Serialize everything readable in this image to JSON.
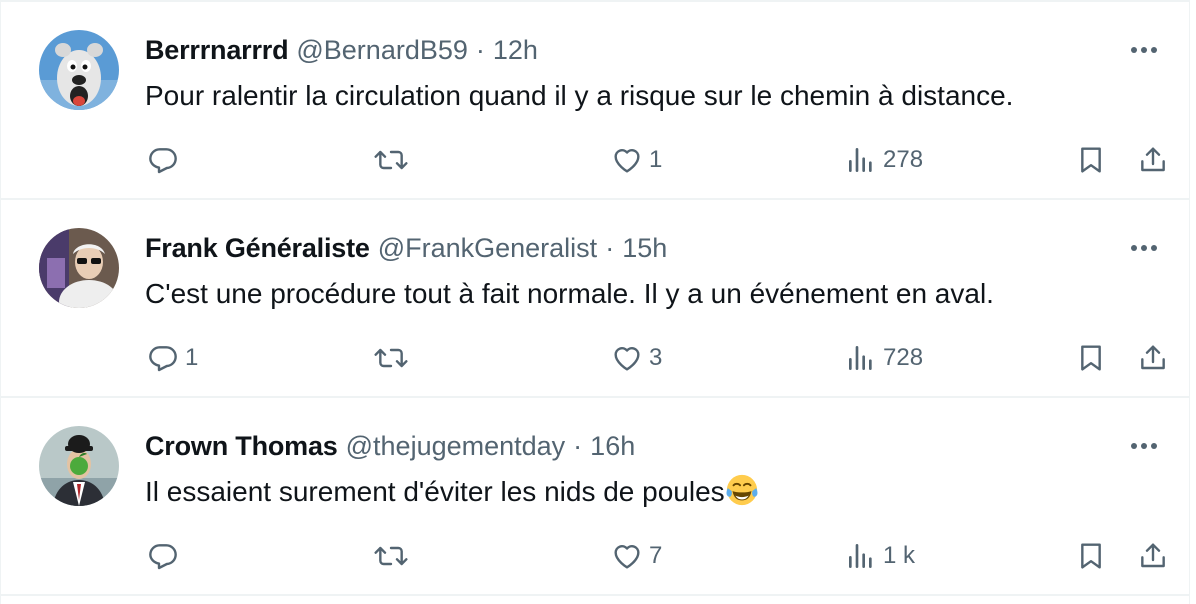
{
  "tweets": [
    {
      "name": "Berrrnarrrd",
      "handle": "@BernardB59",
      "separator": "·",
      "time": "12h",
      "text": "Pour ralentir la circulation quand il y a risque sur le chemin à distance.",
      "reply_count": "",
      "retweet_count": "",
      "like_count": "1",
      "view_count": "278",
      "avatar_icon": "cartoon-bear-avatar"
    },
    {
      "name": "Frank Généraliste",
      "handle": "@FrankGeneralist",
      "separator": "·",
      "time": "15h",
      "text": "C'est une procédure tout à fait normale. Il y a un événement en aval.",
      "reply_count": "1",
      "retweet_count": "",
      "like_count": "3",
      "view_count": "728",
      "avatar_icon": "person-with-sunglasses-avatar"
    },
    {
      "name": "Crown Thomas",
      "handle": "@thejugementday",
      "separator": "·",
      "time": "16h",
      "text": "Il essaient surement d'éviter les nids de poules",
      "emoji": "face-with-tears-of-joy",
      "reply_count": "",
      "retweet_count": "",
      "like_count": "7",
      "view_count": "1 k",
      "avatar_icon": "son-of-man-painting-avatar"
    }
  ],
  "colors": {
    "text_primary": "#0f1419",
    "text_secondary": "#536471",
    "divider": "#eff3f4",
    "background": "#ffffff"
  }
}
